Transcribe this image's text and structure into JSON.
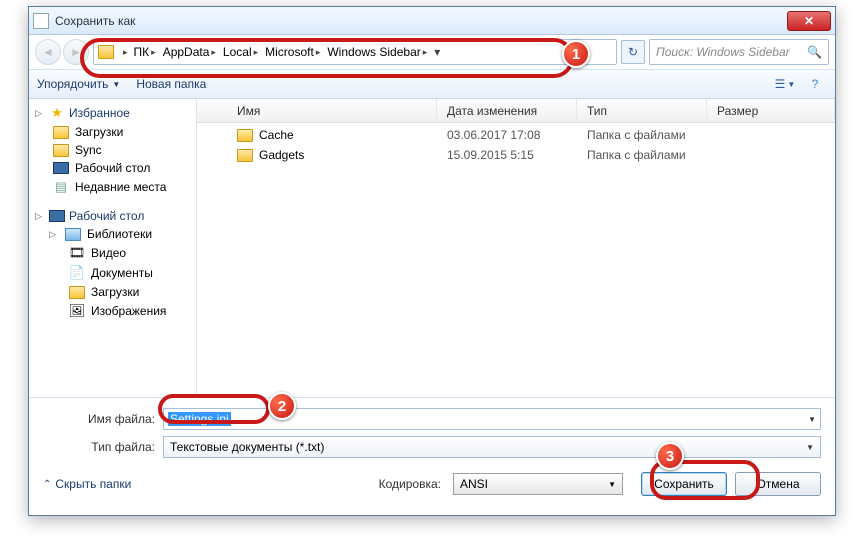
{
  "title": "Сохранить как",
  "breadcrumbs": [
    "ПК",
    "AppData",
    "Local",
    "Microsoft",
    "Windows Sidebar"
  ],
  "search_placeholder": "Поиск: Windows Sidebar",
  "toolbar": {
    "organize": "Упорядочить",
    "newfolder": "Новая папка"
  },
  "columns": {
    "name": "Имя",
    "date": "Дата изменения",
    "type": "Тип",
    "size": "Размер"
  },
  "sidebar": {
    "favorites": "Избранное",
    "fav_items": [
      "Загрузки",
      "Sync",
      "Рабочий стол",
      "Недавние места"
    ],
    "desktop": "Рабочий стол",
    "libraries": "Библиотеки",
    "lib_items": [
      "Видео",
      "Документы",
      "Загрузки",
      "Изображения"
    ]
  },
  "files": [
    {
      "name": "Cache",
      "date": "03.06.2017 17:08",
      "type": "Папка с файлами"
    },
    {
      "name": "Gadgets",
      "date": "15.09.2015 5:15",
      "type": "Папка с файлами"
    }
  ],
  "labels": {
    "filename": "Имя файла:",
    "filetype": "Тип файла:",
    "encoding": "Кодировка:"
  },
  "filename_value": "Settings.ini",
  "filetype_value": "Текстовые документы (*.txt)",
  "encoding_value": "ANSI",
  "buttons": {
    "save": "Сохранить",
    "cancel": "Отмена",
    "hide": "Скрыть папки"
  },
  "badges": {
    "b1": "1",
    "b2": "2",
    "b3": "3"
  }
}
